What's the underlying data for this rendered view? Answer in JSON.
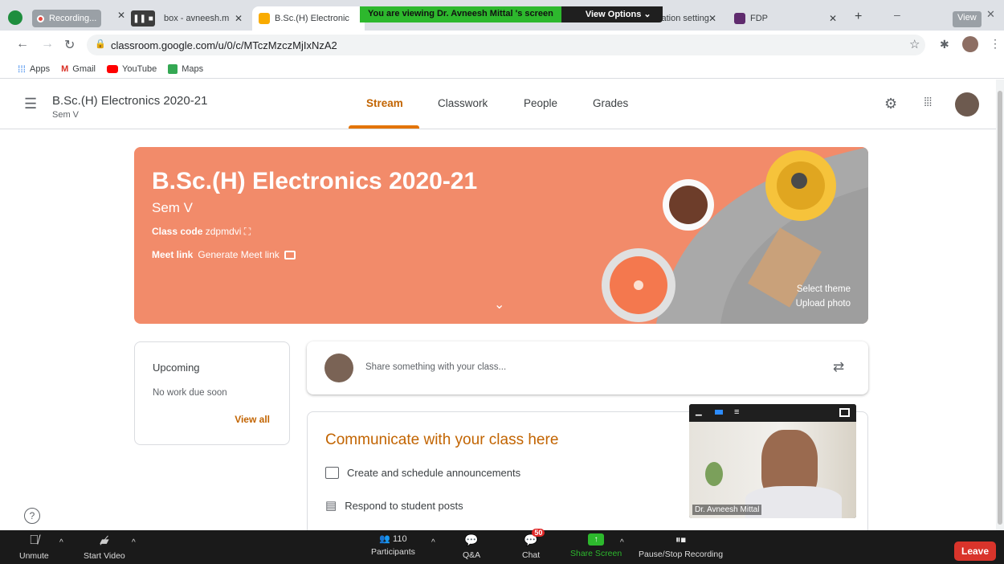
{
  "browser": {
    "tabs": [
      {
        "label": "Recording..."
      },
      {
        "label": "box - avneesh.m"
      },
      {
        "label": "B.Sc.(H) Electronic"
      },
      {
        "label": "cation setting"
      },
      {
        "label": "FDP"
      }
    ],
    "zoom_banner": "You are viewing Dr. Avneesh Mittal 's screen",
    "view_options": "View Options",
    "view_label": "View",
    "url": "classroom.google.com/u/0/c/MTczMzczMjIxNzA2",
    "bookmarks": [
      "Apps",
      "Gmail",
      "YouTube",
      "Maps"
    ]
  },
  "header": {
    "class_name": "B.Sc.(H) Electronics 2020-21",
    "section": "Sem V",
    "tabs": [
      "Stream",
      "Classwork",
      "People",
      "Grades"
    ]
  },
  "banner": {
    "title": "B.Sc.(H) Electronics 2020-21",
    "section": "Sem V",
    "class_code_label": "Class code",
    "class_code": "zdpmdvi",
    "meet_label": "Meet link",
    "meet_action": "Generate Meet link",
    "select_theme": "Select theme",
    "upload_photo": "Upload photo",
    "theme_color": "#f28b6a"
  },
  "upcoming": {
    "title": "Upcoming",
    "empty": "No work due soon",
    "view_all": "View all"
  },
  "share": {
    "placeholder": "Share something with your class..."
  },
  "communicate": {
    "title": "Communicate with your class here",
    "items": [
      "Create and schedule announcements",
      "Respond to student posts"
    ]
  },
  "video": {
    "name": "Dr. Avneesh Mittal"
  },
  "zoom_toolbar": {
    "unmute": "Unmute",
    "start_video": "Start Video",
    "participants": "Participants",
    "participant_count": "110",
    "qa": "Q&A",
    "chat": "Chat",
    "chat_badge": "50",
    "share_screen": "Share Screen",
    "pause_stop": "Pause/Stop Recording",
    "leave": "Leave"
  }
}
